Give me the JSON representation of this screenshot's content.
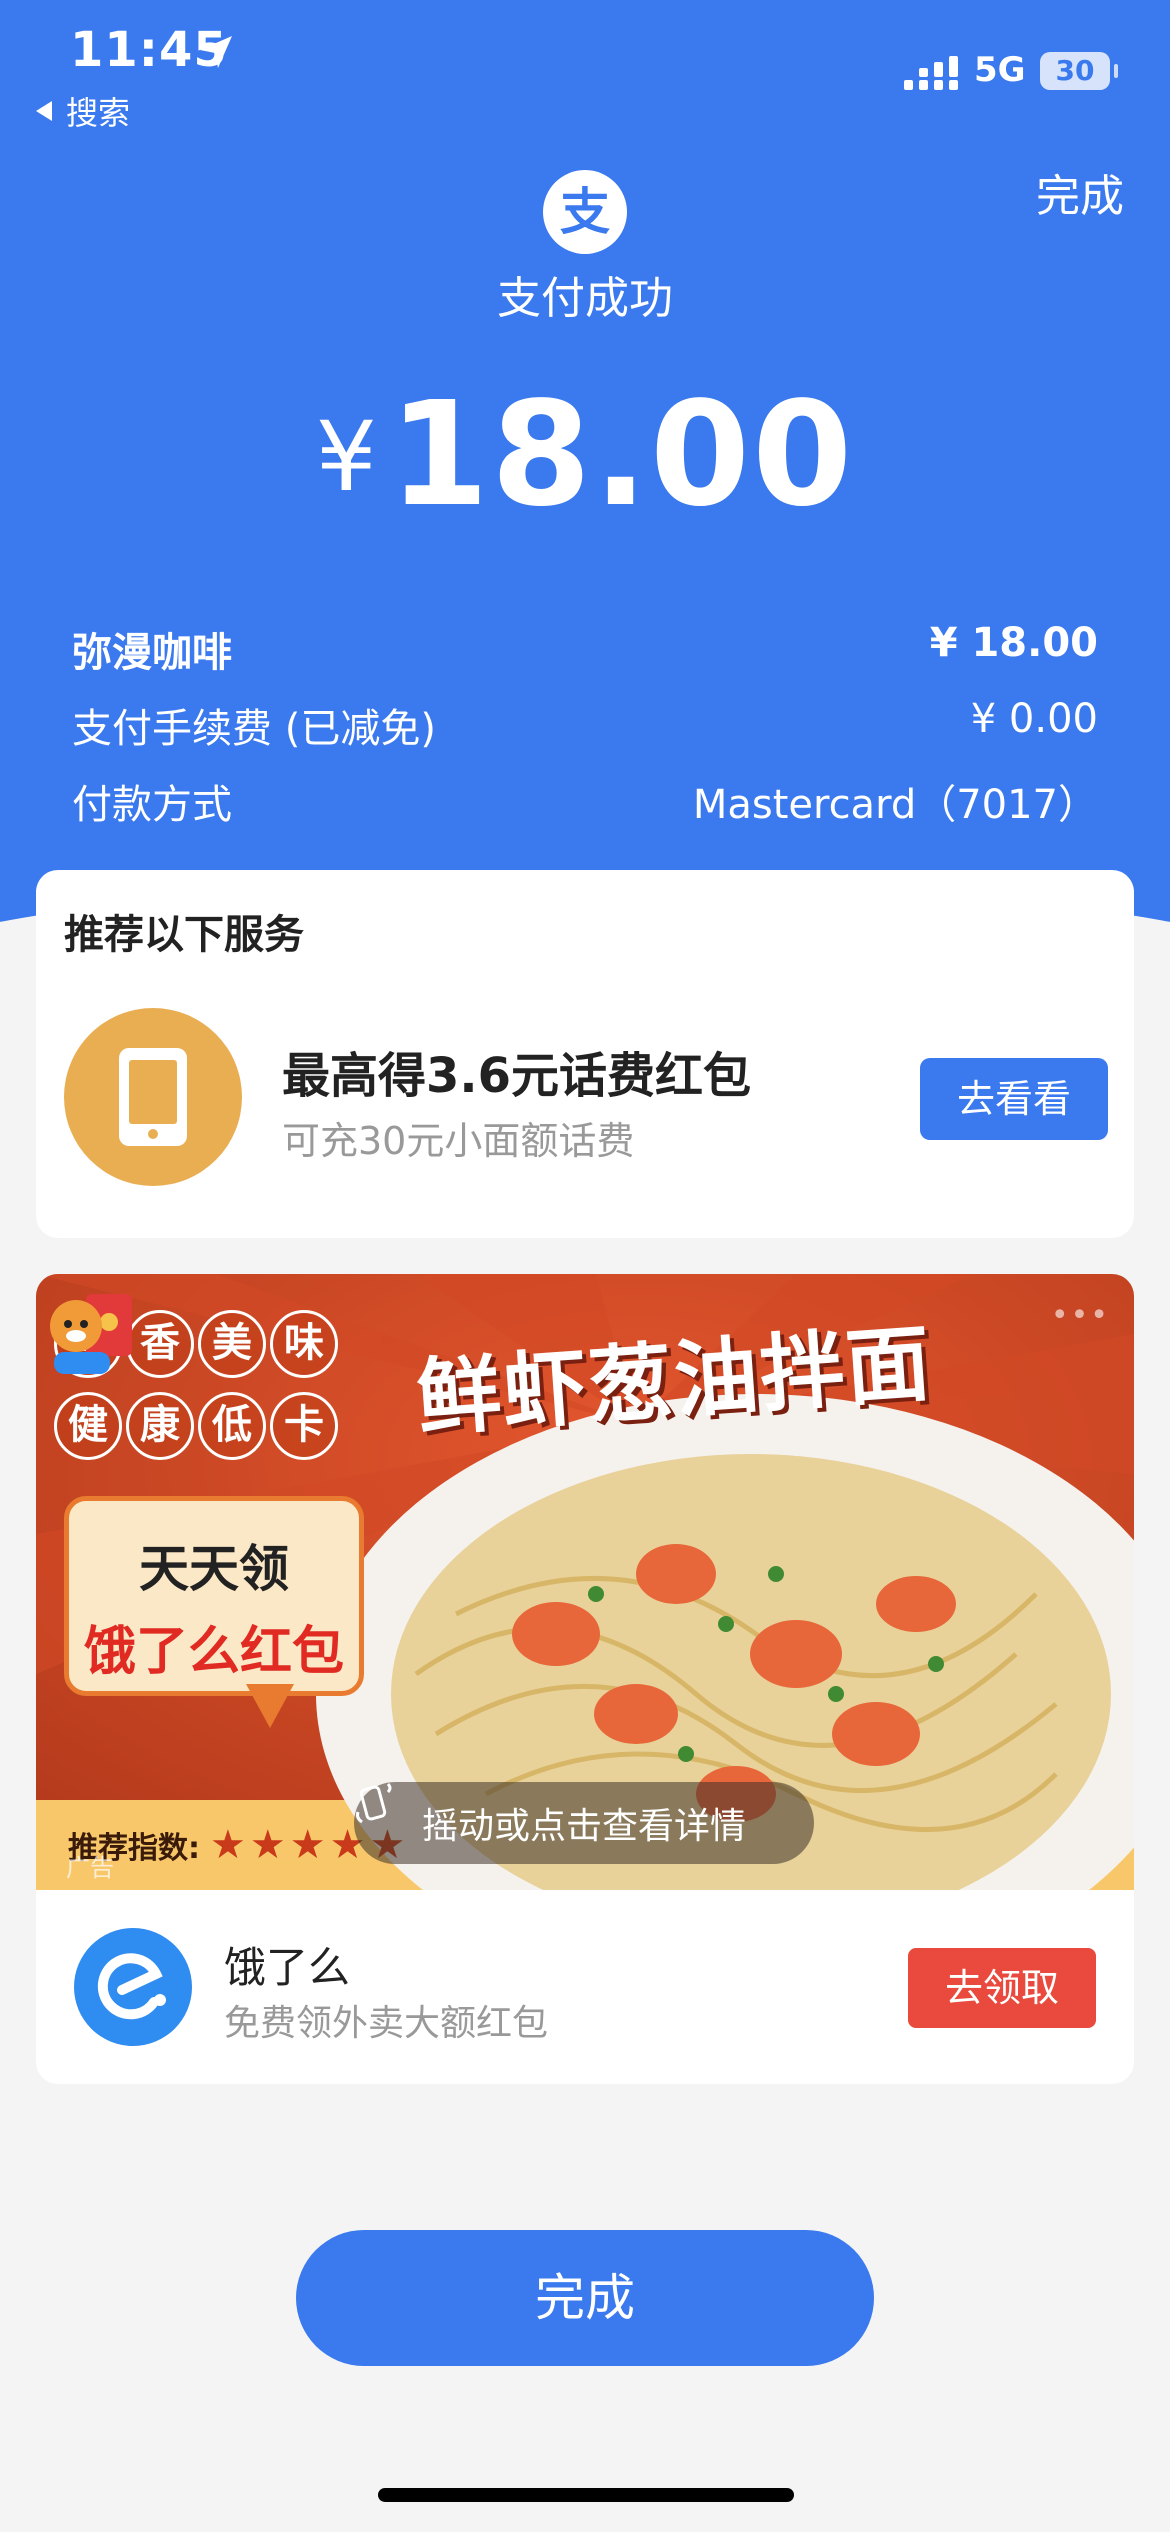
{
  "status_bar": {
    "time": "11:45",
    "back_app": "搜索",
    "network": "5G",
    "battery": "30"
  },
  "header": {
    "done_label": "完成",
    "logo_glyph": "支",
    "title": "支付成功",
    "currency": "¥",
    "amount": "18.00"
  },
  "details": [
    {
      "label": "弥漫咖啡",
      "value": "¥ 18.00"
    },
    {
      "label": "支付手续费 (已减免)",
      "value": "¥ 0.00"
    },
    {
      "label": "付款方式",
      "value": "Mastercard（7017）"
    }
  ],
  "recommend": {
    "title": "推荐以下服务",
    "promo_title": "最高得3.6元话费红包",
    "promo_sub": "可充30元小面额话费",
    "button": "去看看"
  },
  "ad": {
    "tags": [
      "鲜",
      "香",
      "美",
      "味",
      "健",
      "康",
      "低",
      "卡"
    ],
    "headline": "鲜虾葱油拌面",
    "bubble_line1": "天天领",
    "bubble_line2": "饿了么红包",
    "rating_label": "推荐指数:",
    "stars": "★★★★★",
    "ad_label": "广告",
    "shake_text": "摇动或点击查看详情",
    "more": "•••",
    "brand": "饿了么",
    "brand_sub": "免费领外卖大额红包",
    "claim_button": "去领取"
  },
  "footer": {
    "done_label": "完成"
  },
  "colors": {
    "primary_blue": "#3a79ee",
    "claim_red": "#e94a3d",
    "phone_icon_orange": "#e9ae52"
  },
  "icons": [
    "location-arrow-icon",
    "back-triangle-icon",
    "signal-icon",
    "battery-icon",
    "alipay-logo-icon",
    "phone-icon",
    "shake-phone-icon",
    "eleme-logo-icon"
  ]
}
